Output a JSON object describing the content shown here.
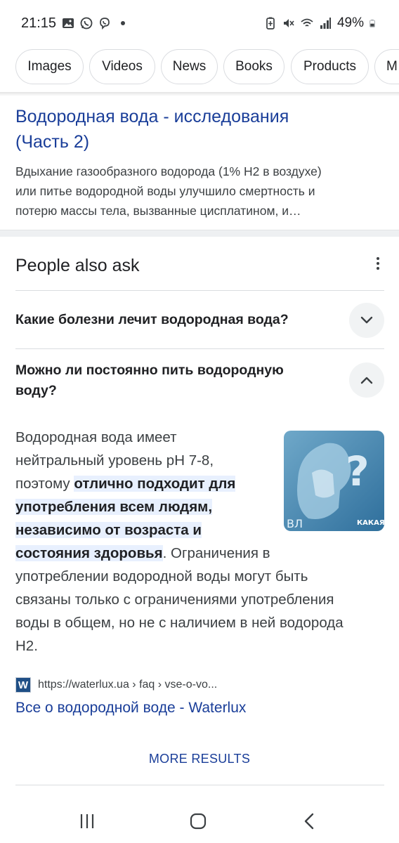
{
  "status_bar": {
    "time": "21:15",
    "battery_percent": "49%",
    "left_icons": [
      "gallery-icon",
      "whatsapp-icon",
      "viber-icon",
      "dot-icon"
    ],
    "right_icons": [
      "battery-saver-icon",
      "mute-icon",
      "wifi-icon",
      "signal-icon",
      "battery-icon"
    ]
  },
  "filter_chips": [
    "Images",
    "Videos",
    "News",
    "Books",
    "Products",
    "M"
  ],
  "result": {
    "title_line1": "Водородная вода - исследования",
    "title_line2": "(Часть 2)",
    "snippet_lines": [
      "Вдыхание газообразного водорода (1% H2 в воздухе)",
      "или питье водородной воды улучшило смертность и",
      "потерю массы тела, вызванные цисплатином, и…"
    ]
  },
  "people_also_ask": {
    "title": "People also ask",
    "questions": [
      {
        "line1": "Какие болезни лечит водородная вода?",
        "line2": "",
        "expanded": false
      },
      {
        "line1": "Можно ли постоянно пить водородную",
        "line2": "воду?",
        "expanded": true
      }
    ],
    "answer": {
      "lines": [
        {
          "plain": "Водородная вода имеет",
          "bold": "",
          "tail": ""
        },
        {
          "plain": "нейтральный уровень pH 7-8,",
          "bold": "",
          "tail": ""
        },
        {
          "plain": "поэтому ",
          "bold": "отлично подходит для",
          "tail": ""
        },
        {
          "plain": "",
          "bold": "употребления всем людям,",
          "tail": ""
        },
        {
          "plain": "",
          "bold": "независимо от возраста и",
          "tail": ""
        },
        {
          "plain": "",
          "bold": "состояния здоровья",
          "tail": ". Ограничения в"
        },
        {
          "plain": "употреблении водородной воды могут быть",
          "bold": "",
          "tail": ""
        },
        {
          "plain": "связаны только с ограничениями употребления",
          "bold": "",
          "tail": ""
        },
        {
          "plain": "воды в общем, но не с наличием в ней водорода",
          "bold": "",
          "tail": ""
        },
        {
          "plain": "H2.",
          "bold": "",
          "tail": ""
        }
      ],
      "image_caption": "КАКАЯ О",
      "image_corner_text": "ВЛ"
    },
    "source": {
      "url": "https://waterlux.ua › faq › vse-o-vo...",
      "title": "Все о водородной воде - Waterlux",
      "favicon_letter": "W"
    },
    "more_results": "MORE RESULTS"
  },
  "colors": {
    "link": "#1a3e99",
    "highlight": "#e8f0fe",
    "text": "#202124",
    "secondary_text": "#3c4043"
  }
}
